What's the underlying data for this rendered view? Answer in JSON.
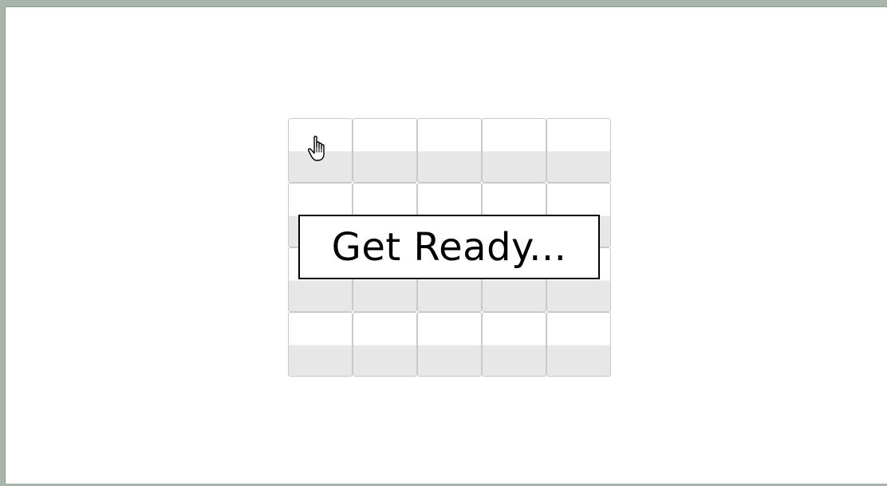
{
  "game": {
    "status_message": "Get Ready...",
    "grid_rows": 4,
    "grid_cols": 5
  },
  "colors": {
    "window_border": "#a8b5ab",
    "tile_top": "#ffffff",
    "tile_bottom": "#e7e7e7",
    "tile_border": "#c9c9c9"
  },
  "icons": {
    "cursor": "hand-pointer-icon"
  }
}
